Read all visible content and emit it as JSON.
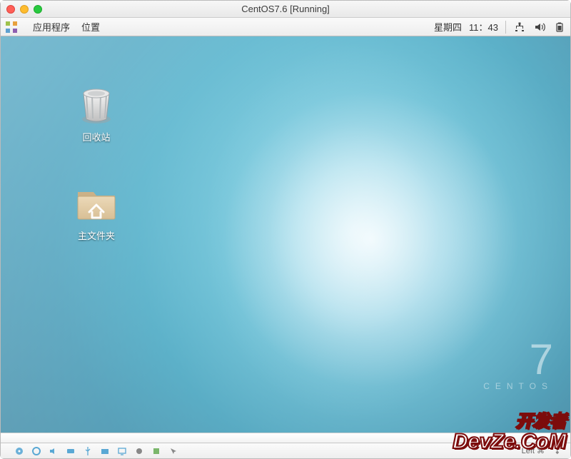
{
  "window": {
    "title": "CentOS7.6 [Running]"
  },
  "gnome": {
    "apps_menu": "应用程序",
    "places_menu": "位置",
    "day": "星期四",
    "time": "11：43"
  },
  "desktop": {
    "trash_label": "回收站",
    "home_label": "主文件夹",
    "os_brand": "CENTOS",
    "os_version": "7"
  },
  "vbox": {
    "host_key": "Left ⌘"
  },
  "watermark": {
    "line1": "开发者",
    "line2": "DevZe.CoM"
  },
  "icons": {
    "apps": "apps-icon",
    "network": "network-icon",
    "volume": "volume-icon",
    "battery": "battery-icon",
    "trash": "trash-icon",
    "home_folder": "home-folder-icon"
  }
}
